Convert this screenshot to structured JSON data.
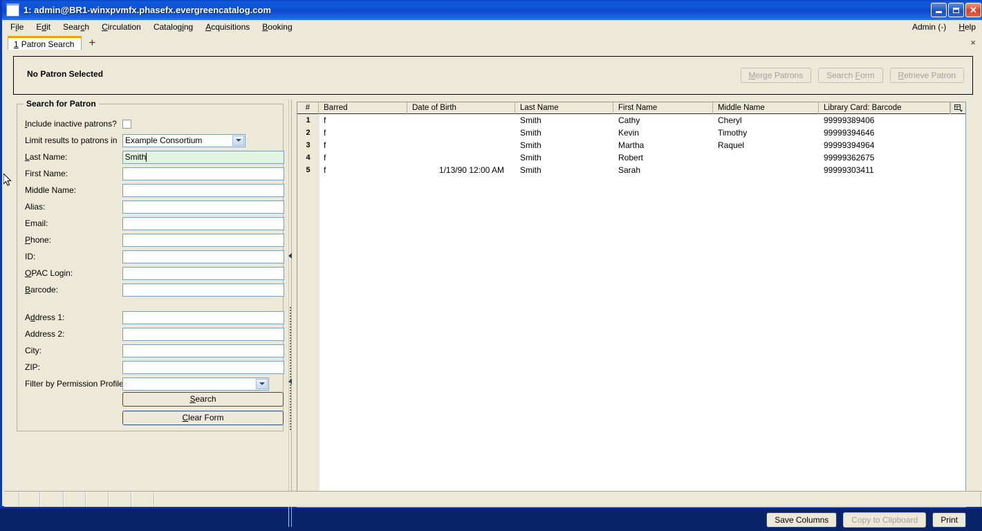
{
  "window": {
    "title": "1: admin@BR1-winxpvmfx.phasefx.evergreencatalog.com",
    "minimize_label": "Minimize",
    "maximize_label": "Maximize",
    "close_label": "Close"
  },
  "menubar": {
    "items": [
      {
        "label": "File",
        "accel_index": 1
      },
      {
        "label": "Edit",
        "accel_index": 1
      },
      {
        "label": "Search",
        "accel_index": 4
      },
      {
        "label": "Circulation",
        "accel_index": 0
      },
      {
        "label": "Cataloging",
        "accel_index": 7
      },
      {
        "label": "Acquisitions",
        "accel_index": 0
      },
      {
        "label": "Booking",
        "accel_index": 0
      }
    ],
    "right_items": [
      {
        "label": "Admin (-)",
        "accel_index": -1
      },
      {
        "label": "Help",
        "accel_index": 0
      }
    ]
  },
  "tabs": {
    "active": {
      "number": "1",
      "label": "Patron Search"
    },
    "add_label": "+",
    "close_label": "×"
  },
  "patron_band": {
    "status": "No Patron Selected",
    "buttons": [
      {
        "label": "Merge Patrons",
        "accel_index": 0,
        "enabled": false
      },
      {
        "label": "Search Form",
        "accel_index": 7,
        "enabled": false
      },
      {
        "label": "Retrieve Patron",
        "accel_index": 0,
        "enabled": false
      }
    ]
  },
  "search_form": {
    "legend": "Search for Patron",
    "fields": [
      {
        "label": "Include inactive patrons?",
        "accel_index": 0,
        "type": "checkbox",
        "value": "",
        "checked": false
      },
      {
        "label": "Limit results to patrons in",
        "accel_index": -1,
        "type": "select",
        "value": "Example Consortium"
      },
      {
        "label": "Last Name:",
        "accel_index": 0,
        "type": "text",
        "value": "Smith",
        "focused": true
      },
      {
        "label": "First Name:",
        "accel_index": -1,
        "type": "text",
        "value": ""
      },
      {
        "label": "Middle Name:",
        "accel_index": -1,
        "type": "text",
        "value": ""
      },
      {
        "label": "Alias:",
        "accel_index": -1,
        "type": "text",
        "value": ""
      },
      {
        "label": "Email:",
        "accel_index": -1,
        "type": "text",
        "value": ""
      },
      {
        "label": "Phone:",
        "accel_index": 0,
        "type": "text",
        "value": ""
      },
      {
        "label": "ID:",
        "accel_index": -1,
        "type": "text",
        "value": ""
      },
      {
        "label": "OPAC Login:",
        "accel_index": 0,
        "type": "text",
        "value": ""
      },
      {
        "label": "Barcode:",
        "accel_index": 0,
        "type": "text",
        "value": ""
      },
      {
        "label": "Address 1:",
        "accel_index": 1,
        "type": "text",
        "value": "",
        "gap_before": true
      },
      {
        "label": "Address 2:",
        "accel_index": -1,
        "type": "text",
        "value": ""
      },
      {
        "label": "City:",
        "accel_index": -1,
        "type": "text",
        "value": ""
      },
      {
        "label": "ZIP:",
        "accel_index": -1,
        "type": "text",
        "value": ""
      },
      {
        "label": "Filter by Permission Profile:",
        "accel_index": -1,
        "type": "select-wide",
        "value": ""
      }
    ],
    "search_button": {
      "label": "Search",
      "accel_index": 1
    },
    "clear_button": {
      "label": "Clear Form",
      "accel_index": 1
    }
  },
  "results": {
    "columns": [
      {
        "key": "num",
        "label": "#",
        "width": 31,
        "align": "center"
      },
      {
        "key": "barred",
        "label": "Barred",
        "width": 128,
        "align": "left"
      },
      {
        "key": "dob",
        "label": "Date of Birth",
        "width": 156,
        "align": "left"
      },
      {
        "key": "last",
        "label": "Last Name",
        "width": 142,
        "align": "left"
      },
      {
        "key": "first",
        "label": "First Name",
        "width": 144,
        "align": "left"
      },
      {
        "key": "middle",
        "label": "Middle Name",
        "width": 153,
        "align": "left"
      },
      {
        "key": "barcode",
        "label": "Library Card: Barcode",
        "width": 190,
        "align": "left"
      }
    ],
    "column_picker_icon": "column-picker-icon",
    "rows": [
      {
        "num": "1",
        "barred": "f",
        "dob": "",
        "last": "Smith",
        "first": "Cathy",
        "middle": "Cheryl",
        "barcode": "99999389406"
      },
      {
        "num": "2",
        "barred": "f",
        "dob": "",
        "last": "Smith",
        "first": "Kevin",
        "middle": "Timothy",
        "barcode": "99999394646"
      },
      {
        "num": "3",
        "barred": "f",
        "dob": "",
        "last": "Smith",
        "first": "Martha",
        "middle": "Raquel",
        "barcode": "99999394964"
      },
      {
        "num": "4",
        "barred": "f",
        "dob": "",
        "last": "Smith",
        "first": "Robert",
        "middle": "",
        "barcode": "99999362675"
      },
      {
        "num": "5",
        "barred": "f",
        "dob": "1/13/90 12:00 AM",
        "last": "Smith",
        "first": "Sarah",
        "middle": "",
        "barcode": "99999303411"
      }
    ],
    "footer_buttons": [
      {
        "label": "Save Columns",
        "enabled": true
      },
      {
        "label": "Copy to Clipboard",
        "enabled": false
      },
      {
        "label": "Print",
        "enabled": true
      }
    ]
  },
  "statusbar": {
    "segments": [
      "",
      "",
      "",
      "",
      "",
      "",
      "",
      ""
    ]
  },
  "colors": {
    "titlebar": "#0b46cc",
    "window_border": "#0b38b5",
    "face": "#ece9d8",
    "field_border": "#7f9db9",
    "focus_field_bg": "#e2f5e0",
    "tab_accent": "#f3a300",
    "header_rule": "#2b2b2b"
  }
}
